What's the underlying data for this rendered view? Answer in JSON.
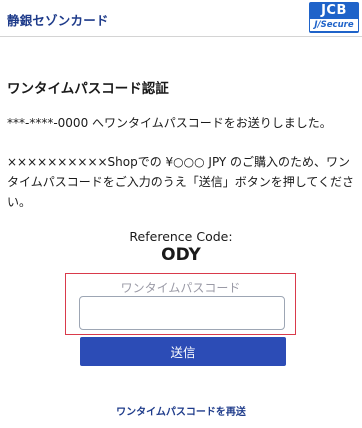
{
  "header": {
    "brand": "静銀セゾンカード",
    "logo_top": "JCB",
    "logo_bottom": "J/Secure"
  },
  "content": {
    "title": "ワンタイムパスコード認証",
    "sent_message": "***-****-0000 へワンタイムパスコードをお送りしました。",
    "instruction": "××××××××××Shopでの ¥○○○ JPY のご購入のため、ワンタイムパスコードをご入力のうえ「送信」ボタンを押してください。",
    "reference_label": "Reference Code:",
    "reference_code": "ODY"
  },
  "form": {
    "passcode_label": "ワンタイムパスコード",
    "passcode_value": "",
    "submit_label": "送信",
    "resend_label": "ワンタイムパスコードを再送"
  },
  "colors": {
    "accent": "#2c4cb6",
    "brand_text": "#1e3b8a",
    "highlight_border": "#d93a4b",
    "jcb_blue": "#1f63c9"
  }
}
